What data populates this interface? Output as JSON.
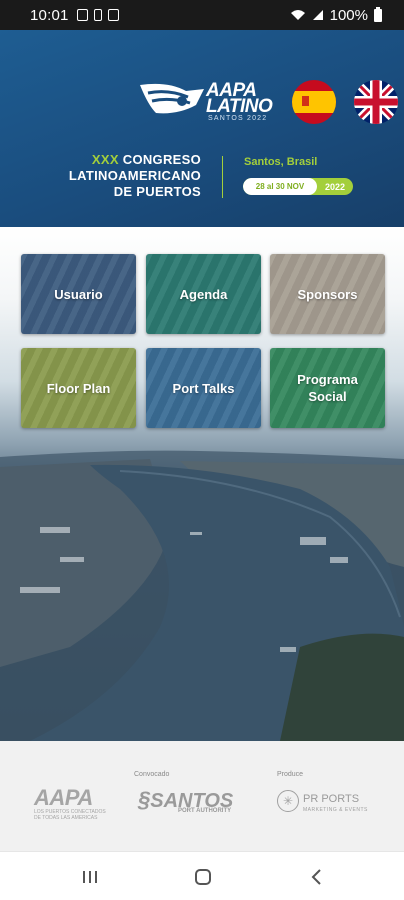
{
  "status_bar": {
    "time": "10:01",
    "battery": "100%"
  },
  "header": {
    "logo": {
      "brand": "AAPA LATINO",
      "subtitle": "SANTOS 2022"
    },
    "language_flags": [
      "es",
      "uk"
    ],
    "congress": {
      "ordinal": "XXX",
      "line1_rest": "CONGRESO",
      "line2": "LATINOAMERICANO",
      "line3": "DE PUERTOS"
    },
    "location": "Santos, Brasil",
    "dates": "28 al 30 NOV",
    "year": "2022"
  },
  "menu": {
    "tiles": [
      {
        "label": "Usuario"
      },
      {
        "label": "Agenda"
      },
      {
        "label": "Sponsors"
      },
      {
        "label": "Floor Plan"
      },
      {
        "label": "Port Talks"
      },
      {
        "label": "Programa Social"
      }
    ]
  },
  "footer": {
    "convocatoria_label": "Convocado",
    "produce_label": "Produce",
    "aapa_logo": "AAPA",
    "aapa_sub": "LOS PUERTOS CONECTADOS DE TODAS LAS AMERICAS",
    "santos_logo": "SANTOS",
    "santos_sub": "PORT AUTHORITY",
    "prports_logo": "PR PORTS",
    "prports_sub": "MARKETING & EVENTS"
  },
  "colors": {
    "header_blue": "#1a4d7e",
    "accent_green": "#a3cf3b"
  }
}
